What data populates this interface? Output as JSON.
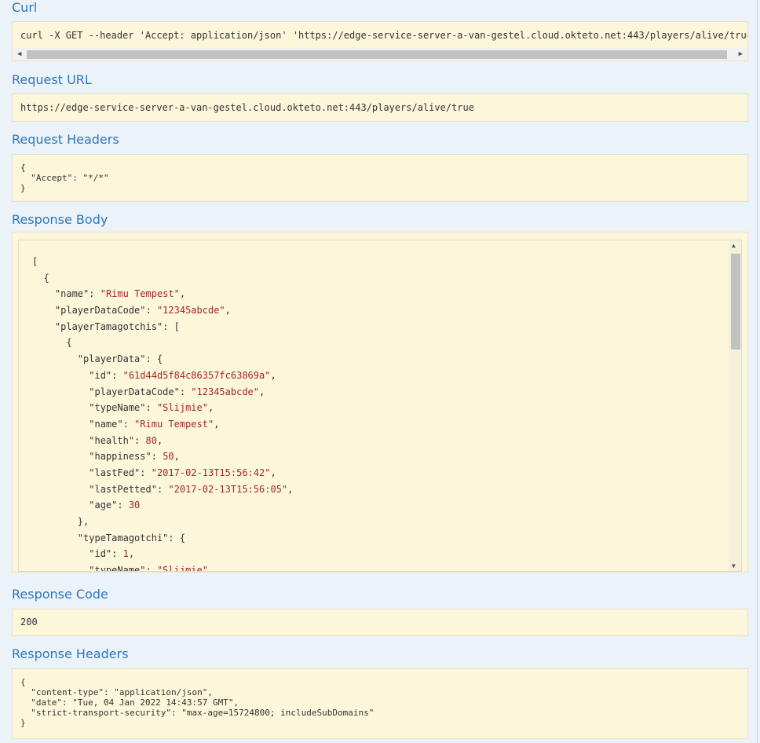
{
  "curl": {
    "title": "Curl",
    "command": "curl -X GET --header 'Accept: application/json' 'https://edge-service-server-a-van-gestel.cloud.okteto.net:443/players/alive/true'"
  },
  "request_url": {
    "title": "Request URL",
    "value": "https://edge-service-server-a-van-gestel.cloud.okteto.net:443/players/alive/true"
  },
  "request_headers": {
    "title": "Request Headers",
    "lines": [
      "{",
      "  \"Accept\": \"*/*\"",
      "}"
    ]
  },
  "response_body": {
    "title": "Response Body",
    "lines": [
      {
        "indent": 0,
        "text": "["
      },
      {
        "indent": 2,
        "text": "{"
      },
      {
        "indent": 4,
        "key": "name",
        "value": "\"Rimu Tempest\"",
        "suffix": ","
      },
      {
        "indent": 4,
        "key": "playerDataCode",
        "value": "\"12345abcde\"",
        "suffix": ","
      },
      {
        "indent": 4,
        "key": "playerTamagotchis",
        "raw": ": ["
      },
      {
        "indent": 6,
        "text": "{"
      },
      {
        "indent": 8,
        "key": "playerData",
        "raw": ": {"
      },
      {
        "indent": 10,
        "key": "id",
        "value": "\"61d44d5f84c86357fc63869a\"",
        "suffix": ","
      },
      {
        "indent": 10,
        "key": "playerDataCode",
        "value": "\"12345abcde\"",
        "suffix": ","
      },
      {
        "indent": 10,
        "key": "typeName",
        "value": "\"Slijmie\"",
        "suffix": ","
      },
      {
        "indent": 10,
        "key": "name",
        "value": "\"Rimu Tempest\"",
        "suffix": ","
      },
      {
        "indent": 10,
        "key": "health",
        "value": "80",
        "suffix": ","
      },
      {
        "indent": 10,
        "key": "happiness",
        "value": "50",
        "suffix": ","
      },
      {
        "indent": 10,
        "key": "lastFed",
        "value": "\"2017-02-13T15:56:42\"",
        "suffix": ","
      },
      {
        "indent": 10,
        "key": "lastPetted",
        "value": "\"2017-02-13T15:56:05\"",
        "suffix": ","
      },
      {
        "indent": 10,
        "key": "age",
        "value": "30",
        "suffix": ""
      },
      {
        "indent": 8,
        "text": "},"
      },
      {
        "indent": 8,
        "key": "typeTamagotchi",
        "raw": ": {"
      },
      {
        "indent": 10,
        "key": "id",
        "value": "1",
        "suffix": ","
      },
      {
        "indent": 10,
        "key": "typeName",
        "value": "\"Slijmie\"",
        "suffix": ","
      }
    ]
  },
  "response_code": {
    "title": "Response Code",
    "value": "200"
  },
  "response_headers": {
    "title": "Response Headers",
    "lines": [
      "{",
      "  \"content-type\": \"application/json\",",
      "  \"date\": \"Tue, 04 Jan 2022 14:43:57 GMT\",",
      "  \"strict-transport-security\": \"max-age=15724800; includeSubDomains\"",
      "}"
    ]
  },
  "colors": {
    "heading": "#2e77b8",
    "box_background": "#fcf6db",
    "json_value": "#a42828",
    "page_background": "#ebf3f9"
  }
}
